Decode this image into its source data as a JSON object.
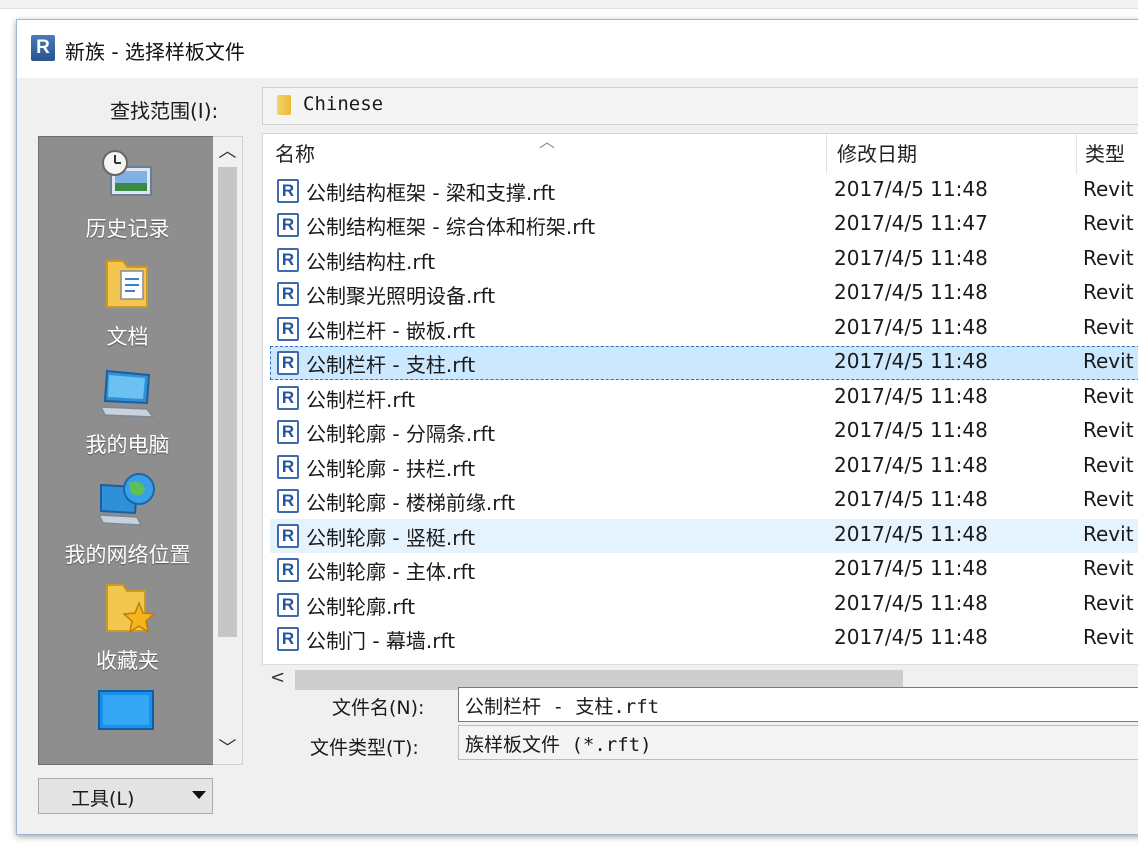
{
  "dialog": {
    "title": "新族 - 选择样板文件",
    "app_icon_letter": "R"
  },
  "look_in": {
    "label": "查找范围(I):",
    "value": "Chinese"
  },
  "places": [
    {
      "label": "历史记录",
      "icon": "history-icon"
    },
    {
      "label": "文档",
      "icon": "documents-folder-icon"
    },
    {
      "label": "我的电脑",
      "icon": "computer-icon"
    },
    {
      "label": "我的网络位置",
      "icon": "network-icon"
    },
    {
      "label": "收藏夹",
      "icon": "favorites-folder-icon"
    },
    {
      "label": "",
      "icon": "desktop-icon"
    }
  ],
  "columns": {
    "name": "名称",
    "date": "修改日期",
    "type": "类型"
  },
  "files": [
    {
      "name": "公制结构框架 - 梁和支撑.rft",
      "date": "2017/4/5 11:48",
      "type": "Revit"
    },
    {
      "name": "公制结构框架 - 综合体和桁架.rft",
      "date": "2017/4/5 11:47",
      "type": "Revit"
    },
    {
      "name": "公制结构柱.rft",
      "date": "2017/4/5 11:48",
      "type": "Revit"
    },
    {
      "name": "公制聚光照明设备.rft",
      "date": "2017/4/5 11:48",
      "type": "Revit"
    },
    {
      "name": "公制栏杆 - 嵌板.rft",
      "date": "2017/4/5 11:48",
      "type": "Revit"
    },
    {
      "name": "公制栏杆 - 支柱.rft",
      "date": "2017/4/5 11:48",
      "type": "Revit"
    },
    {
      "name": "公制栏杆.rft",
      "date": "2017/4/5 11:48",
      "type": "Revit"
    },
    {
      "name": "公制轮廓 - 分隔条.rft",
      "date": "2017/4/5 11:48",
      "type": "Revit"
    },
    {
      "name": "公制轮廓 - 扶栏.rft",
      "date": "2017/4/5 11:48",
      "type": "Revit"
    },
    {
      "name": "公制轮廓 - 楼梯前缘.rft",
      "date": "2017/4/5 11:48",
      "type": "Revit"
    },
    {
      "name": "公制轮廓 - 竖梃.rft",
      "date": "2017/4/5 11:48",
      "type": "Revit"
    },
    {
      "name": "公制轮廓 - 主体.rft",
      "date": "2017/4/5 11:48",
      "type": "Revit"
    },
    {
      "name": "公制轮廓.rft",
      "date": "2017/4/5 11:48",
      "type": "Revit"
    },
    {
      "name": "公制门 - 幕墙.rft",
      "date": "2017/4/5 11:48",
      "type": "Revit"
    }
  ],
  "file_name": {
    "label": "文件名(N):",
    "value": "公制栏杆 - 支柱.rft"
  },
  "file_type": {
    "label": "文件类型(T):",
    "value": "族样板文件 (*.rft)"
  },
  "tools": {
    "label": "工具(L)"
  },
  "colors": {
    "selection": "#cce8ff",
    "hover": "#e5f3ff",
    "places_bg": "#8e8e8e"
  }
}
